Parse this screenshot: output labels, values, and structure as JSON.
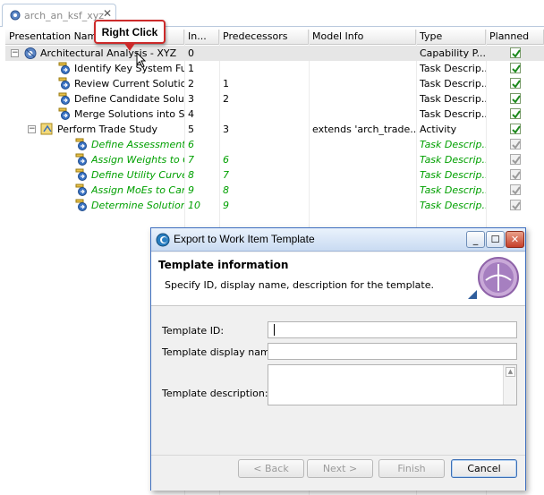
{
  "editor": {
    "tab_label": "arch_an_ksf_xyz",
    "close_glyph": "✕"
  },
  "table": {
    "columns": [
      "Presentation Name",
      "In...",
      "Predecessors",
      "Model Info",
      "Type",
      "Planned"
    ],
    "rows": [
      {
        "indent": 0,
        "expander": "−",
        "icon": "capability-pattern-icon",
        "name": "Architectural Analysis - XYZ",
        "index": "0",
        "pred": "",
        "model": "",
        "type": "Capability P...",
        "planned": true,
        "green": false,
        "selected": true
      },
      {
        "indent": 2,
        "expander": "",
        "icon": "task-descriptor-icon",
        "name": "Identify Key System Functions",
        "index": "1",
        "pred": "",
        "model": "",
        "type": "Task Descrip...",
        "planned": true,
        "green": false,
        "selected": false
      },
      {
        "indent": 2,
        "expander": "",
        "icon": "task-descriptor-icon",
        "name": "Review Current Solutions",
        "index": "2",
        "pred": "1",
        "model": "",
        "type": "Task Descrip...",
        "planned": true,
        "green": false,
        "selected": false
      },
      {
        "indent": 2,
        "expander": "",
        "icon": "task-descriptor-icon",
        "name": "Define Candidate Solutions",
        "index": "3",
        "pred": "2",
        "model": "",
        "type": "Task Descrip...",
        "planned": true,
        "green": false,
        "selected": false
      },
      {
        "indent": 2,
        "expander": "",
        "icon": "task-descriptor-icon",
        "name": "Merge Solutions into System",
        "index": "4",
        "pred": "",
        "model": "",
        "type": "Task Descrip...",
        "planned": true,
        "green": false,
        "selected": false
      },
      {
        "indent": 1,
        "expander": "−",
        "icon": "activity-icon",
        "name": "Perform Trade Study",
        "index": "5",
        "pred": "3",
        "model": "extends 'arch_trade...",
        "type": "Activity",
        "planned": true,
        "green": false,
        "selected": false
      },
      {
        "indent": 3,
        "expander": "",
        "icon": "task-descriptor-icon",
        "name": "Define Assessment Criteria",
        "index": "6",
        "pred": "",
        "model": "",
        "type": "Task Descrip...",
        "planned": true,
        "green": true,
        "selected": false
      },
      {
        "indent": 3,
        "expander": "",
        "icon": "task-descriptor-icon",
        "name": "Assign Weights to Criteria",
        "index": "7",
        "pred": "6",
        "model": "",
        "type": "Task Descrip...",
        "planned": true,
        "green": true,
        "selected": false
      },
      {
        "indent": 3,
        "expander": "",
        "icon": "task-descriptor-icon",
        "name": "Define Utility Curve for each",
        "index": "8",
        "pred": "7",
        "model": "",
        "type": "Task Descrip...",
        "planned": true,
        "green": true,
        "selected": false
      },
      {
        "indent": 3,
        "expander": "",
        "icon": "task-descriptor-icon",
        "name": "Assign MoEs to Candidates",
        "index": "9",
        "pred": "8",
        "model": "",
        "type": "Task Descrip...",
        "planned": true,
        "green": true,
        "selected": false
      },
      {
        "indent": 3,
        "expander": "",
        "icon": "task-descriptor-icon",
        "name": "Determine Solution",
        "index": "10",
        "pred": "9",
        "model": "",
        "type": "Task Descrip...",
        "planned": true,
        "green": true,
        "selected": false
      }
    ]
  },
  "callout": {
    "text": "Right Click"
  },
  "dialog": {
    "title": "Export to Work Item Template",
    "min_glyph": "_",
    "max_glyph": "☐",
    "close_glyph": "✕",
    "header_title": "Template information",
    "header_desc": "Specify ID, display name, description for the template.",
    "fields": {
      "id_label": "Template ID:",
      "id_value": "",
      "name_label": "Template display name:",
      "name_value": "",
      "desc_label": "Template description:",
      "desc_value": ""
    },
    "buttons": {
      "back": "< Back",
      "next": "Next >",
      "finish": "Finish",
      "cancel": "Cancel"
    }
  },
  "colors": {
    "selection": "#e6e6e6",
    "green_text": "#00a000",
    "callout_border": "#cc2a2a",
    "title_bar": "#c9dbf2"
  }
}
